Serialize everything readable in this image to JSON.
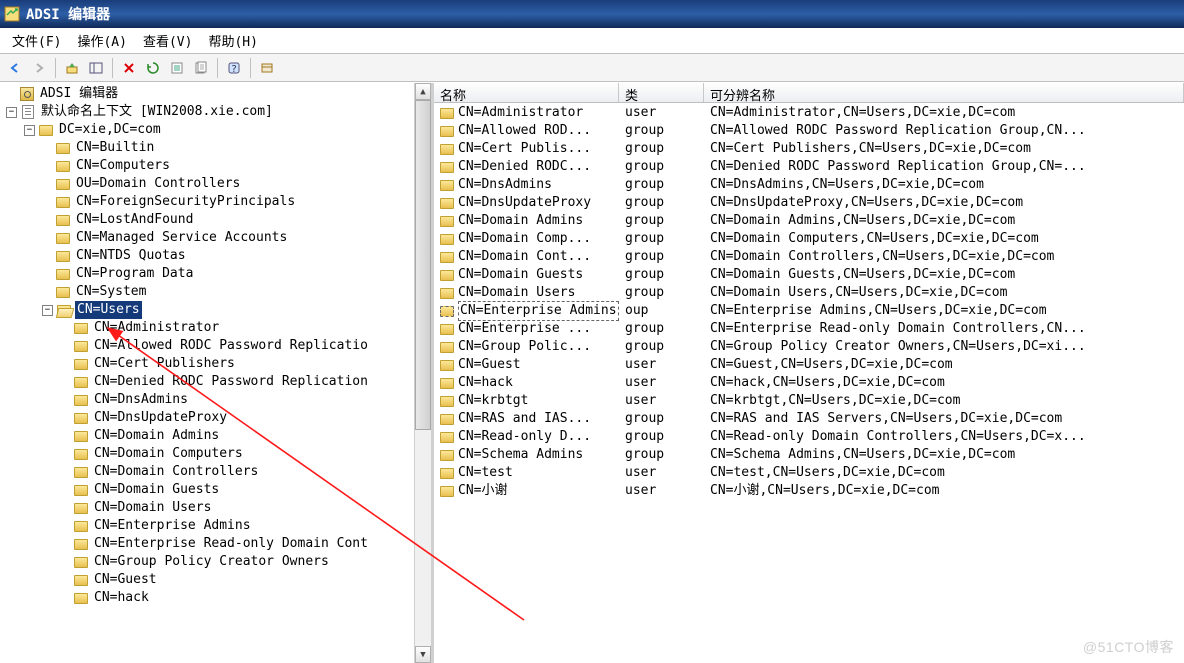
{
  "title": "ADSI 编辑器",
  "menubar": [
    "文件(F)",
    "操作(A)",
    "查看(V)",
    "帮助(H)"
  ],
  "columns": {
    "name": "名称",
    "class": "类",
    "dn": "可分辨名称"
  },
  "tree": [
    {
      "depth": 0,
      "toggle": "",
      "icon": "root",
      "label": "ADSI 编辑器"
    },
    {
      "depth": 0,
      "toggle": "-",
      "icon": "doc",
      "label": "默认命名上下文 [WIN2008.xie.com]"
    },
    {
      "depth": 1,
      "toggle": "-",
      "icon": "folder",
      "label": "DC=xie,DC=com"
    },
    {
      "depth": 2,
      "toggle": "",
      "icon": "folder",
      "label": "CN=Builtin"
    },
    {
      "depth": 2,
      "toggle": "",
      "icon": "folder",
      "label": "CN=Computers"
    },
    {
      "depth": 2,
      "toggle": "",
      "icon": "folder",
      "label": "OU=Domain Controllers"
    },
    {
      "depth": 2,
      "toggle": "",
      "icon": "folder",
      "label": "CN=ForeignSecurityPrincipals"
    },
    {
      "depth": 2,
      "toggle": "",
      "icon": "folder",
      "label": "CN=LostAndFound"
    },
    {
      "depth": 2,
      "toggle": "",
      "icon": "folder",
      "label": "CN=Managed Service Accounts"
    },
    {
      "depth": 2,
      "toggle": "",
      "icon": "folder",
      "label": "CN=NTDS Quotas"
    },
    {
      "depth": 2,
      "toggle": "",
      "icon": "folder",
      "label": "CN=Program Data"
    },
    {
      "depth": 2,
      "toggle": "",
      "icon": "folder",
      "label": "CN=System"
    },
    {
      "depth": 2,
      "toggle": "-",
      "icon": "folder-open",
      "label": "CN=Users",
      "selected": true
    },
    {
      "depth": 3,
      "toggle": "",
      "icon": "folder",
      "label": "CN=Administrator"
    },
    {
      "depth": 3,
      "toggle": "",
      "icon": "folder",
      "label": "CN=Allowed RODC Password Replicatio"
    },
    {
      "depth": 3,
      "toggle": "",
      "icon": "folder",
      "label": "CN=Cert Publishers"
    },
    {
      "depth": 3,
      "toggle": "",
      "icon": "folder",
      "label": "CN=Denied RODC Password Replication"
    },
    {
      "depth": 3,
      "toggle": "",
      "icon": "folder",
      "label": "CN=DnsAdmins"
    },
    {
      "depth": 3,
      "toggle": "",
      "icon": "folder",
      "label": "CN=DnsUpdateProxy"
    },
    {
      "depth": 3,
      "toggle": "",
      "icon": "folder",
      "label": "CN=Domain Admins"
    },
    {
      "depth": 3,
      "toggle": "",
      "icon": "folder",
      "label": "CN=Domain Computers"
    },
    {
      "depth": 3,
      "toggle": "",
      "icon": "folder",
      "label": "CN=Domain Controllers"
    },
    {
      "depth": 3,
      "toggle": "",
      "icon": "folder",
      "label": "CN=Domain Guests"
    },
    {
      "depth": 3,
      "toggle": "",
      "icon": "folder",
      "label": "CN=Domain Users"
    },
    {
      "depth": 3,
      "toggle": "",
      "icon": "folder",
      "label": "CN=Enterprise Admins"
    },
    {
      "depth": 3,
      "toggle": "",
      "icon": "folder",
      "label": "CN=Enterprise Read-only Domain Cont"
    },
    {
      "depth": 3,
      "toggle": "",
      "icon": "folder",
      "label": "CN=Group Policy Creator Owners"
    },
    {
      "depth": 3,
      "toggle": "",
      "icon": "folder",
      "label": "CN=Guest"
    },
    {
      "depth": 3,
      "toggle": "",
      "icon": "folder",
      "label": "CN=hack"
    }
  ],
  "list": [
    {
      "name": "CN=Administrator",
      "class": "user",
      "dn": "CN=Administrator,CN=Users,DC=xie,DC=com"
    },
    {
      "name": "CN=Allowed ROD...",
      "class": "group",
      "dn": "CN=Allowed RODC Password Replication Group,CN..."
    },
    {
      "name": "CN=Cert Publis...",
      "class": "group",
      "dn": "CN=Cert Publishers,CN=Users,DC=xie,DC=com"
    },
    {
      "name": "CN=Denied RODC...",
      "class": "group",
      "dn": "CN=Denied RODC Password Replication Group,CN=..."
    },
    {
      "name": "CN=DnsAdmins",
      "class": "group",
      "dn": "CN=DnsAdmins,CN=Users,DC=xie,DC=com"
    },
    {
      "name": "CN=DnsUpdateProxy",
      "class": "group",
      "dn": "CN=DnsUpdateProxy,CN=Users,DC=xie,DC=com"
    },
    {
      "name": "CN=Domain Admins",
      "class": "group",
      "dn": "CN=Domain Admins,CN=Users,DC=xie,DC=com"
    },
    {
      "name": "CN=Domain Comp...",
      "class": "group",
      "dn": "CN=Domain Computers,CN=Users,DC=xie,DC=com"
    },
    {
      "name": "CN=Domain Cont...",
      "class": "group",
      "dn": "CN=Domain Controllers,CN=Users,DC=xie,DC=com"
    },
    {
      "name": "CN=Domain Guests",
      "class": "group",
      "dn": "CN=Domain Guests,CN=Users,DC=xie,DC=com"
    },
    {
      "name": "CN=Domain Users",
      "class": "group",
      "dn": "CN=Domain Users,CN=Users,DC=xie,DC=com"
    },
    {
      "name": "CN=Enterprise Admins",
      "class": "oup",
      "dn": "CN=Enterprise Admins,CN=Users,DC=xie,DC=com",
      "boxed": true
    },
    {
      "name": "CN=Enterprise ...",
      "class": "group",
      "dn": "CN=Enterprise Read-only Domain Controllers,CN..."
    },
    {
      "name": "CN=Group Polic...",
      "class": "group",
      "dn": "CN=Group Policy Creator Owners,CN=Users,DC=xi..."
    },
    {
      "name": "CN=Guest",
      "class": "user",
      "dn": "CN=Guest,CN=Users,DC=xie,DC=com"
    },
    {
      "name": "CN=hack",
      "class": "user",
      "dn": "CN=hack,CN=Users,DC=xie,DC=com"
    },
    {
      "name": "CN=krbtgt",
      "class": "user",
      "dn": "CN=krbtgt,CN=Users,DC=xie,DC=com"
    },
    {
      "name": "CN=RAS and IAS...",
      "class": "group",
      "dn": "CN=RAS and IAS Servers,CN=Users,DC=xie,DC=com"
    },
    {
      "name": "CN=Read-only D...",
      "class": "group",
      "dn": "CN=Read-only Domain Controllers,CN=Users,DC=x..."
    },
    {
      "name": "CN=Schema Admins",
      "class": "group",
      "dn": "CN=Schema Admins,CN=Users,DC=xie,DC=com"
    },
    {
      "name": "CN=test",
      "class": "user",
      "dn": "CN=test,CN=Users,DC=xie,DC=com"
    },
    {
      "name": "CN=小谢",
      "class": "user",
      "dn": "CN=小谢,CN=Users,DC=xie,DC=com"
    }
  ],
  "watermark": "@51CTO博客"
}
